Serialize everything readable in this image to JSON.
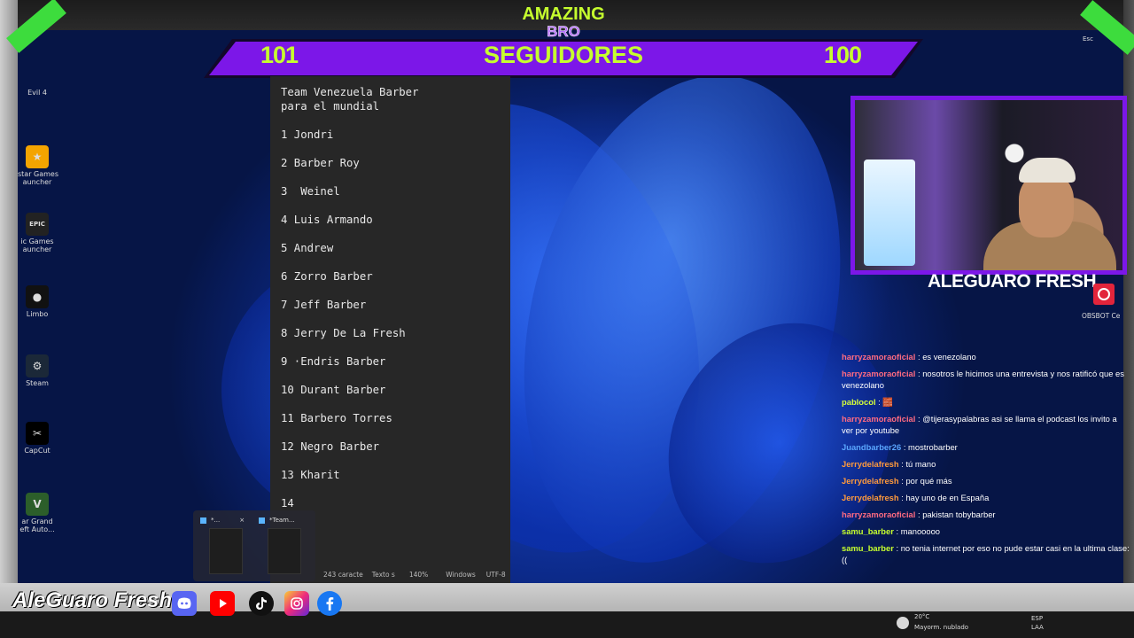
{
  "overlay": {
    "brand_line1": "AMAZING",
    "brand_line2": "BRO",
    "banner_left": "101",
    "banner_title": "SEGUIDORES",
    "banner_right": "100",
    "streamer_name": "ALEGUARO FRESH",
    "channel_name": "AleGuaro Fresh",
    "accent_color": "#7c17e8",
    "highlight_color": "#c6ff2e"
  },
  "desktop_icons": [
    {
      "label": "Evil 4",
      "icon": "game-icon"
    },
    {
      "label": "star Games\nauncher",
      "icon": "rockstar-icon"
    },
    {
      "label": "ic Games\nauncher",
      "icon": "epic-games-icon"
    },
    {
      "label": "Limbo",
      "icon": "limbo-icon"
    },
    {
      "label": "Steam",
      "icon": "steam-icon"
    },
    {
      "label": "CapCut",
      "icon": "capcut-icon"
    },
    {
      "label": "ar Grand\neft Auto...",
      "icon": "gta-icon"
    }
  ],
  "right_desktop": {
    "top_label": "Esc",
    "obs_label": "OBSBOT Ce"
  },
  "notepad": {
    "lines": [
      "Team Venezuela Barber",
      "para el mundial",
      "",
      "1 Jondri",
      "",
      "2 Barber Roy",
      "",
      "3  Weinel",
      "",
      "4 Luis Armando",
      "",
      "5 Andrew",
      "",
      "6 Zorro Barber",
      "",
      "7 Jeff Barber",
      "",
      "8 Jerry De La Fresh",
      "",
      "9 ·Endris Barber",
      "",
      "10 Durant Barber",
      "",
      "11 Barbero Torres",
      "",
      "12 Negro Barber",
      "",
      "13 Kharit",
      "",
      "14"
    ],
    "status": {
      "chars": "243 caracte",
      "format": "Texto s",
      "zoom": "140%",
      "eol": "Windows",
      "encoding": "UTF-8"
    }
  },
  "taskbar_thumbs": [
    {
      "title": "*...",
      "close": "×"
    },
    {
      "title": "*Team..."
    }
  ],
  "chat": [
    {
      "user": "harryzamoraoficial",
      "color": "#ff6b81",
      "text": "es venezolano"
    },
    {
      "user": "harryzamoraoficial",
      "color": "#ff6b81",
      "text": "nosotros le hicimos una entrevista y nos ratificó que es venezolano"
    },
    {
      "user": "pablocol",
      "color": "#d7ff3a",
      "text": "🧱"
    },
    {
      "user": "harryzamoraoficial",
      "color": "#ff6b81",
      "text": "@tijerasypalabras asi se llama el podcast los invito a ver por youtube"
    },
    {
      "user": "Juandbarber26",
      "color": "#5aa6ff",
      "text": "mostrobarber"
    },
    {
      "user": "Jerrydelafresh",
      "color": "#ff9a3c",
      "text": "tú mano"
    },
    {
      "user": "Jerrydelafresh",
      "color": "#ff9a3c",
      "text": "por qué más"
    },
    {
      "user": "Jerrydelafresh",
      "color": "#ff9a3c",
      "text": "hay uno de en España"
    },
    {
      "user": "harryzamoraoficial",
      "color": "#ff6b81",
      "text": "pakistan tobybarber"
    },
    {
      "user": "samu_barber",
      "color": "#c6ff2e",
      "text": "manooooo"
    },
    {
      "user": "samu_barber",
      "color": "#c6ff2e",
      "text": "no tenia internet por eso no pude estar casi en la ultima clase:(("
    }
  ],
  "social_icons": [
    "discord-icon",
    "youtube-icon",
    "tiktok-icon",
    "instagram-icon",
    "facebook-icon"
  ],
  "tray": {
    "temp": "20°C",
    "weather": "Mayorm. nublado",
    "lang": "ESP",
    "lang2": "LAA"
  }
}
